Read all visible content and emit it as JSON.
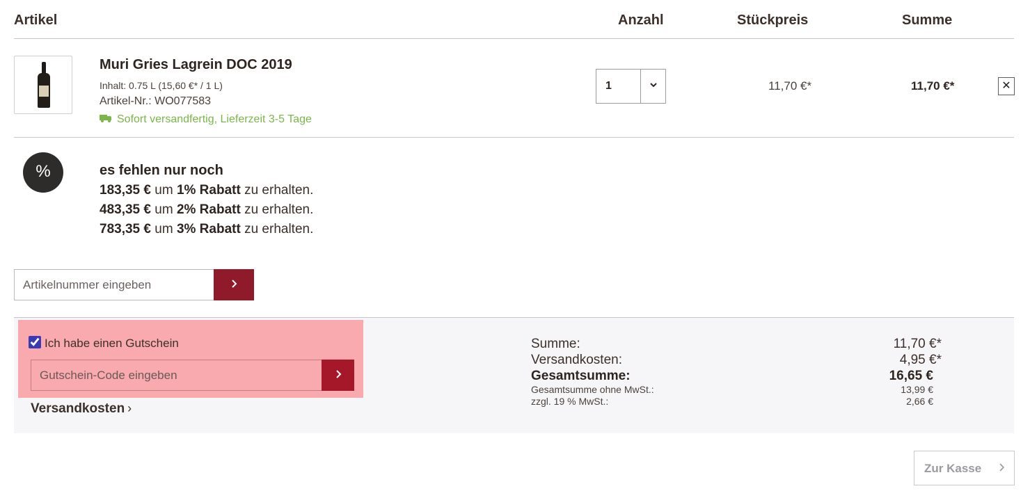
{
  "table_header": {
    "article": "Artikel",
    "quantity": "Anzahl",
    "unit_price": "Stückpreis",
    "sum": "Summe"
  },
  "item": {
    "name": "Muri Gries Lagrein DOC 2019",
    "content": "Inhalt: 0.75 L (15,60 €* / 1 L)",
    "article_number": "Artikel-Nr.: WO077583",
    "delivery": "Sofort versandfertig, Lieferzeit 3-5 Tage",
    "quantity": "1",
    "unit_price": "11,70 €*",
    "line_sum": "11,70 €*",
    "remove_label": "✕"
  },
  "discount": {
    "icon": "%",
    "title": "es fehlen nur noch",
    "tiers": [
      {
        "amount": "183,35 €",
        "mid": "um",
        "rate": "1% Rabatt",
        "tail": "zu erhalten."
      },
      {
        "amount": "483,35 €",
        "mid": "um",
        "rate": "2% Rabatt",
        "tail": "zu erhalten."
      },
      {
        "amount": "783,35 €",
        "mid": "um",
        "rate": "3% Rabatt",
        "tail": "zu erhalten."
      }
    ]
  },
  "article_entry": {
    "placeholder": "Artikelnummer eingeben"
  },
  "voucher": {
    "checkbox_label": "Ich habe einen Gutschein",
    "checked": true,
    "placeholder": "Gutschein-Code eingeben"
  },
  "shipping_link": "Versandkosten",
  "totals": {
    "sum_label": "Summe:",
    "sum_value": "11,70 €*",
    "shipping_label": "Versandkosten:",
    "shipping_value": "4,95 €*",
    "grand_label": "Gesamtsumme:",
    "grand_value": "16,65 €",
    "net_label": "Gesamtsumme ohne MwSt.:",
    "net_value": "13,99 €",
    "vat_label": "zzgl. 19 % MwSt.:",
    "vat_value": "2,66 €"
  },
  "checkout_label": "Zur Kasse",
  "colors": {
    "brand": "#8e1a2a",
    "delivery_green": "#7ab648",
    "highlight": "#f8aaae"
  }
}
